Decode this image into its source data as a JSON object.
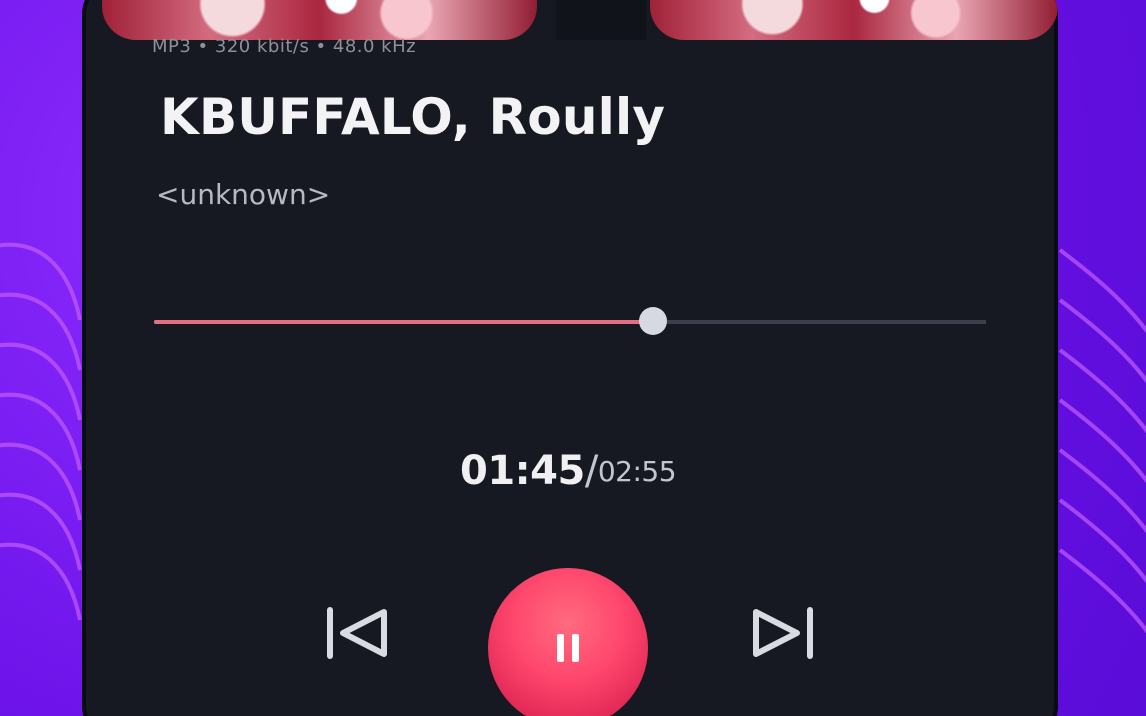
{
  "player": {
    "file_info": "MP3 • 320 kbit/s • 48.0 kHz",
    "title": "KBUFFALO, Roully",
    "artist": "<unknown>",
    "progress_fraction": 0.6,
    "current_time": "01:45",
    "separator": "/",
    "total_time": "02:55",
    "colors": {
      "background": "#7b1fe6",
      "panel": "#171922",
      "accent": "#ff476d",
      "seek_fill": "#e66e81"
    },
    "icons": {
      "previous": "skip-previous-icon",
      "play_pause": "pause-icon",
      "next": "skip-next-icon"
    }
  }
}
